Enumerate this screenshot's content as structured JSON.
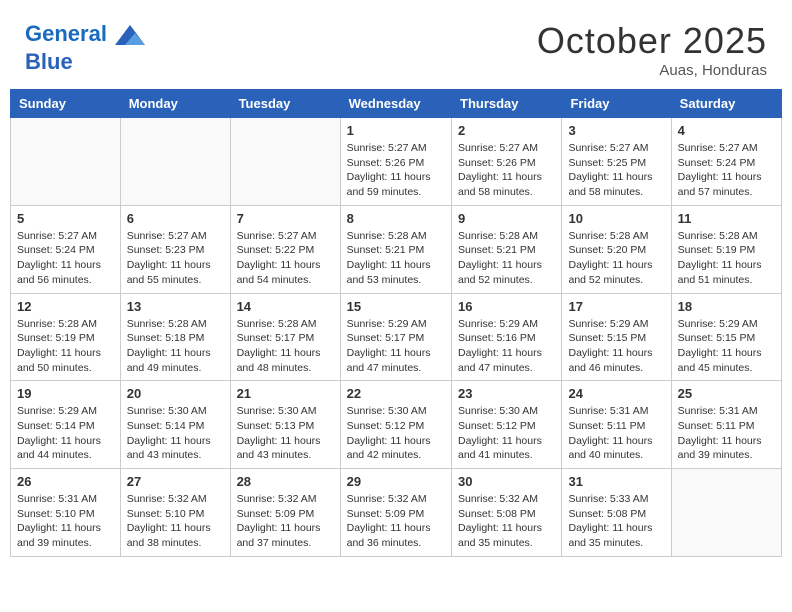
{
  "header": {
    "logo_line1": "General",
    "logo_line2": "Blue",
    "month": "October 2025",
    "location": "Auas, Honduras"
  },
  "weekdays": [
    "Sunday",
    "Monday",
    "Tuesday",
    "Wednesday",
    "Thursday",
    "Friday",
    "Saturday"
  ],
  "weeks": [
    [
      {
        "day": "",
        "info": ""
      },
      {
        "day": "",
        "info": ""
      },
      {
        "day": "",
        "info": ""
      },
      {
        "day": "1",
        "info": "Sunrise: 5:27 AM\nSunset: 5:26 PM\nDaylight: 11 hours\nand 59 minutes."
      },
      {
        "day": "2",
        "info": "Sunrise: 5:27 AM\nSunset: 5:26 PM\nDaylight: 11 hours\nand 58 minutes."
      },
      {
        "day": "3",
        "info": "Sunrise: 5:27 AM\nSunset: 5:25 PM\nDaylight: 11 hours\nand 58 minutes."
      },
      {
        "day": "4",
        "info": "Sunrise: 5:27 AM\nSunset: 5:24 PM\nDaylight: 11 hours\nand 57 minutes."
      }
    ],
    [
      {
        "day": "5",
        "info": "Sunrise: 5:27 AM\nSunset: 5:24 PM\nDaylight: 11 hours\nand 56 minutes."
      },
      {
        "day": "6",
        "info": "Sunrise: 5:27 AM\nSunset: 5:23 PM\nDaylight: 11 hours\nand 55 minutes."
      },
      {
        "day": "7",
        "info": "Sunrise: 5:27 AM\nSunset: 5:22 PM\nDaylight: 11 hours\nand 54 minutes."
      },
      {
        "day": "8",
        "info": "Sunrise: 5:28 AM\nSunset: 5:21 PM\nDaylight: 11 hours\nand 53 minutes."
      },
      {
        "day": "9",
        "info": "Sunrise: 5:28 AM\nSunset: 5:21 PM\nDaylight: 11 hours\nand 52 minutes."
      },
      {
        "day": "10",
        "info": "Sunrise: 5:28 AM\nSunset: 5:20 PM\nDaylight: 11 hours\nand 52 minutes."
      },
      {
        "day": "11",
        "info": "Sunrise: 5:28 AM\nSunset: 5:19 PM\nDaylight: 11 hours\nand 51 minutes."
      }
    ],
    [
      {
        "day": "12",
        "info": "Sunrise: 5:28 AM\nSunset: 5:19 PM\nDaylight: 11 hours\nand 50 minutes."
      },
      {
        "day": "13",
        "info": "Sunrise: 5:28 AM\nSunset: 5:18 PM\nDaylight: 11 hours\nand 49 minutes."
      },
      {
        "day": "14",
        "info": "Sunrise: 5:28 AM\nSunset: 5:17 PM\nDaylight: 11 hours\nand 48 minutes."
      },
      {
        "day": "15",
        "info": "Sunrise: 5:29 AM\nSunset: 5:17 PM\nDaylight: 11 hours\nand 47 minutes."
      },
      {
        "day": "16",
        "info": "Sunrise: 5:29 AM\nSunset: 5:16 PM\nDaylight: 11 hours\nand 47 minutes."
      },
      {
        "day": "17",
        "info": "Sunrise: 5:29 AM\nSunset: 5:15 PM\nDaylight: 11 hours\nand 46 minutes."
      },
      {
        "day": "18",
        "info": "Sunrise: 5:29 AM\nSunset: 5:15 PM\nDaylight: 11 hours\nand 45 minutes."
      }
    ],
    [
      {
        "day": "19",
        "info": "Sunrise: 5:29 AM\nSunset: 5:14 PM\nDaylight: 11 hours\nand 44 minutes."
      },
      {
        "day": "20",
        "info": "Sunrise: 5:30 AM\nSunset: 5:14 PM\nDaylight: 11 hours\nand 43 minutes."
      },
      {
        "day": "21",
        "info": "Sunrise: 5:30 AM\nSunset: 5:13 PM\nDaylight: 11 hours\nand 43 minutes."
      },
      {
        "day": "22",
        "info": "Sunrise: 5:30 AM\nSunset: 5:12 PM\nDaylight: 11 hours\nand 42 minutes."
      },
      {
        "day": "23",
        "info": "Sunrise: 5:30 AM\nSunset: 5:12 PM\nDaylight: 11 hours\nand 41 minutes."
      },
      {
        "day": "24",
        "info": "Sunrise: 5:31 AM\nSunset: 5:11 PM\nDaylight: 11 hours\nand 40 minutes."
      },
      {
        "day": "25",
        "info": "Sunrise: 5:31 AM\nSunset: 5:11 PM\nDaylight: 11 hours\nand 39 minutes."
      }
    ],
    [
      {
        "day": "26",
        "info": "Sunrise: 5:31 AM\nSunset: 5:10 PM\nDaylight: 11 hours\nand 39 minutes."
      },
      {
        "day": "27",
        "info": "Sunrise: 5:32 AM\nSunset: 5:10 PM\nDaylight: 11 hours\nand 38 minutes."
      },
      {
        "day": "28",
        "info": "Sunrise: 5:32 AM\nSunset: 5:09 PM\nDaylight: 11 hours\nand 37 minutes."
      },
      {
        "day": "29",
        "info": "Sunrise: 5:32 AM\nSunset: 5:09 PM\nDaylight: 11 hours\nand 36 minutes."
      },
      {
        "day": "30",
        "info": "Sunrise: 5:32 AM\nSunset: 5:08 PM\nDaylight: 11 hours\nand 35 minutes."
      },
      {
        "day": "31",
        "info": "Sunrise: 5:33 AM\nSunset: 5:08 PM\nDaylight: 11 hours\nand 35 minutes."
      },
      {
        "day": "",
        "info": ""
      }
    ]
  ]
}
